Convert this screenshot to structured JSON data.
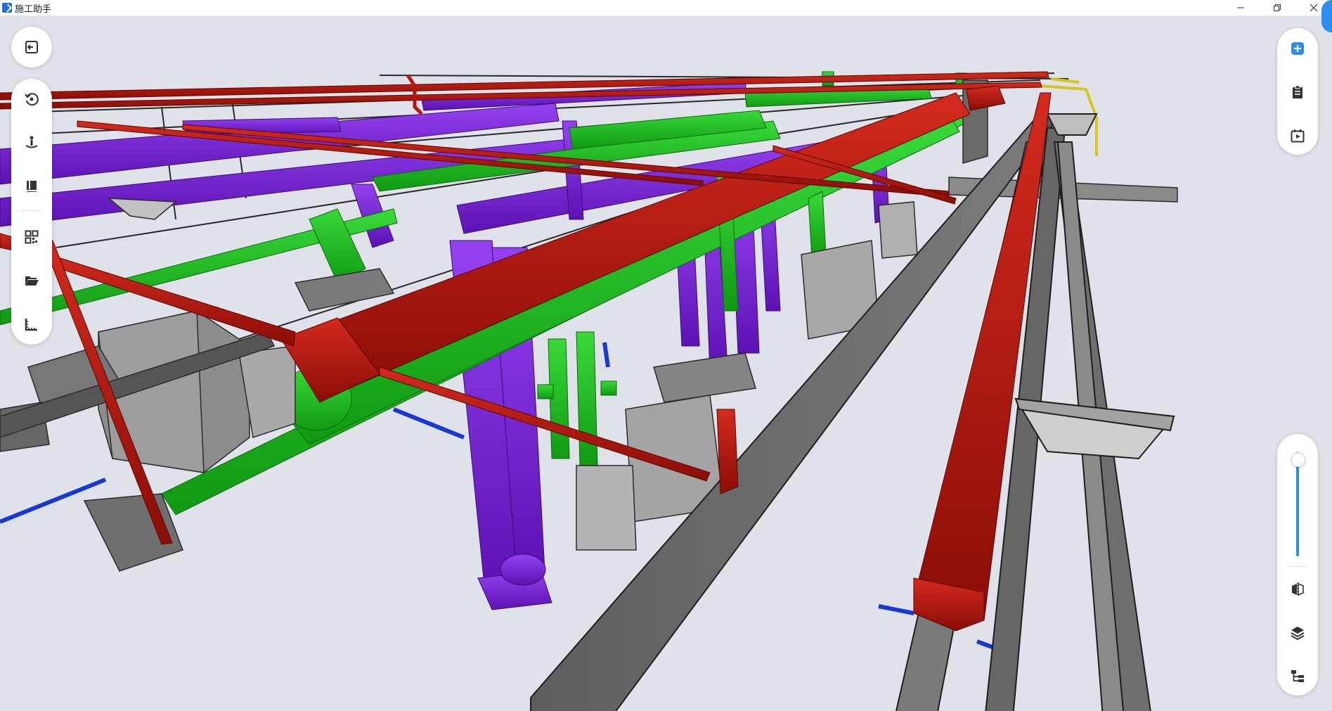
{
  "window": {
    "title": "施工助手"
  },
  "icons": {
    "exit": "exit-icon",
    "reset_view": "reset-view-icon",
    "walk": "walk-mode-icon",
    "book": "book-icon",
    "qr": "qr-code-icon",
    "folder": "folder-open-icon",
    "measure": "measure-ruler-icon",
    "add": "add-icon",
    "clipboard": "clipboard-icon",
    "play": "play-calendar-icon",
    "section": "section-box-icon",
    "layers": "layers-icon",
    "tree": "model-tree-icon"
  },
  "zoom_slider": {
    "value_fraction": 0.92
  },
  "colors": {
    "accent": "#2d8cf0",
    "pipe_red": "#b5160e",
    "pipe_green": "#19b81a",
    "pipe_purple": "#7a1fdc",
    "pipe_blue": "#1838d6",
    "pipe_yellow": "#d8c51b",
    "structure_gray": "#6d6d6d",
    "background": "#dfe2e8"
  }
}
